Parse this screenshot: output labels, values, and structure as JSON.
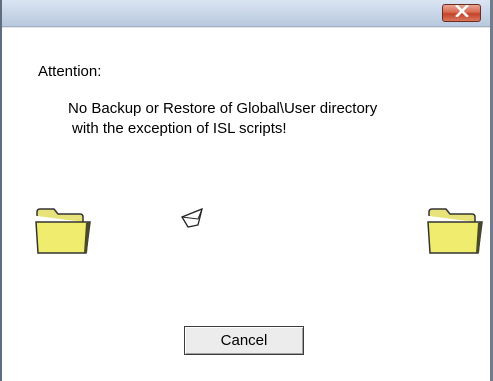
{
  "dialog": {
    "title": "",
    "close_icon": "close-icon",
    "attention_label": "Attention:",
    "message_line1": "No Backup or Restore of Global\\User directory",
    "message_line2": "with the exception of ISL scripts!",
    "cancel_label": "Cancel",
    "icons": [
      "folder-icon",
      "flying-paper-icon",
      "folder-icon"
    ],
    "colors": {
      "close_button": "#c4432a",
      "folder_fill": "#f0ec6e",
      "titlebar": "#c7d5e7"
    }
  }
}
